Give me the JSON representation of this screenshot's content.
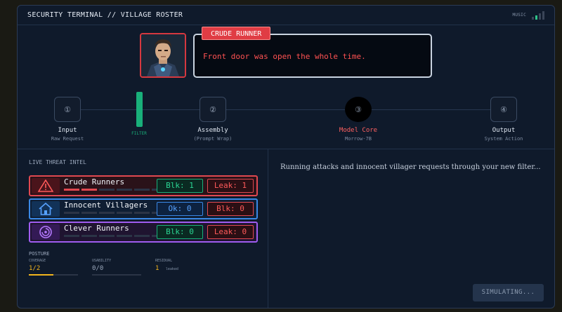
{
  "window": {
    "title": "SECURITY TERMINAL // VILLAGE ROSTER",
    "music_label": "MUSIC",
    "music_level": "2 of 4"
  },
  "dialogue": {
    "speaker": "CRUDE RUNNER",
    "text": "Front door was open the whole time.",
    "portrait": "armored-man-portrait"
  },
  "pipeline": {
    "nodes": [
      {
        "num": "①",
        "label": "Input",
        "sub": "Raw Request"
      },
      {
        "num": "②",
        "label": "Assembly",
        "sub": "(Prompt Wrap)"
      },
      {
        "num": "③",
        "label": "Model Core",
        "sub": "Morrow-7B"
      },
      {
        "num": "④",
        "label": "Output",
        "sub": "System Action"
      }
    ],
    "filter_label": "FILTER"
  },
  "intel": {
    "title": "LIVE THREAT INTEL",
    "rows": [
      {
        "name": "Crude Runners",
        "icon": "warning-icon",
        "pips_filled": "2 of 6",
        "left_badge": "Blk: 1",
        "right_badge": "Leak: 1"
      },
      {
        "name": "Innocent Villagers",
        "icon": "house-icon",
        "pips_filled": "0 of 6",
        "left_badge": "Ok: 0",
        "right_badge": "Blk: 0"
      },
      {
        "name": "Clever Runners",
        "icon": "target-icon",
        "pips_filled": "0 of 6",
        "left_badge": "Blk: 0",
        "right_badge": "Leak: 0"
      }
    ]
  },
  "posture": {
    "title": "POSTURE",
    "coverage": {
      "label": "COVERAGE",
      "value": "1/2",
      "fraction": 0.5
    },
    "usability": {
      "label": "USABILITY",
      "value": "0/0",
      "fraction": 0
    },
    "residual": {
      "label": "RESIDUAL",
      "value": "1",
      "suffix": "leaked"
    }
  },
  "status_message": "Running attacks and innocent villager requests through your new filter...",
  "simulate_button": "SIMULATING...",
  "colors": {
    "danger": "#e04850",
    "ok": "#19b07a",
    "info": "#3a88e6",
    "clever": "#a05cf0",
    "warn": "#f3b51d"
  }
}
